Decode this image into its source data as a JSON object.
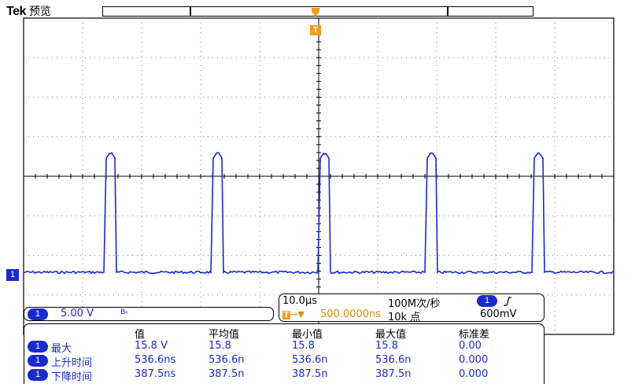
{
  "header": {
    "brand": "Tek",
    "mode": "预览"
  },
  "trigger": {
    "marker_label": "T"
  },
  "channel": {
    "marker_label": "1",
    "scale": "5.00 V",
    "bw_flag": "Bₕ",
    "color": "#1a2acb"
  },
  "timebase": {
    "time_per_div": "10.0µs",
    "sample_rate": "100M次/秒",
    "position_icon": "T→▼",
    "position": "500.0000ns",
    "record_length": "10k 点",
    "trigger_channel": "1",
    "trigger_slope_icon": "rising-edge-icon",
    "trigger_level": "600mV"
  },
  "measurements": {
    "columns": [
      "值",
      "平均值",
      "最小值",
      "最大值",
      "标准差"
    ],
    "rows": [
      {
        "channel": "1",
        "name": "最大",
        "values": [
          "15.8 V",
          "15.8",
          "15.8",
          "15.8",
          "0.00"
        ]
      },
      {
        "channel": "1",
        "name": "上升时间",
        "values": [
          "536.6ns",
          "536.6n",
          "536.6n",
          "536.6n",
          "0.000"
        ]
      },
      {
        "channel": "1",
        "name": "下降时间",
        "values": [
          "387.5ns",
          "387.5n",
          "387.5n",
          "387.5n",
          "0.000"
        ]
      }
    ]
  },
  "colors": {
    "trace": "#1a2acb",
    "trigger": "#f0a020",
    "accent_text": "#1a2acb"
  }
}
